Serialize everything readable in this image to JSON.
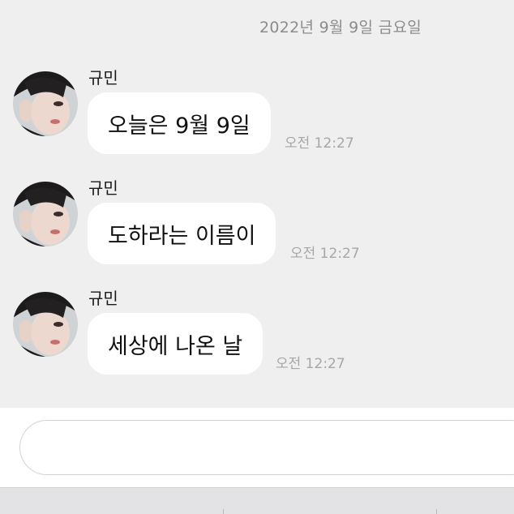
{
  "chat": {
    "date_divider": "2022년 9월 9일 금요일",
    "messages": [
      {
        "sender": "규민",
        "text": "오늘은 9월 9일",
        "time": "오전 12:27"
      },
      {
        "sender": "규민",
        "text": "도하라는 이름이",
        "time": "오전 12:27"
      },
      {
        "sender": "규민",
        "text": "세상에 나온 날",
        "time": "오전 12:27"
      }
    ]
  },
  "input": {
    "placeholder": ""
  }
}
